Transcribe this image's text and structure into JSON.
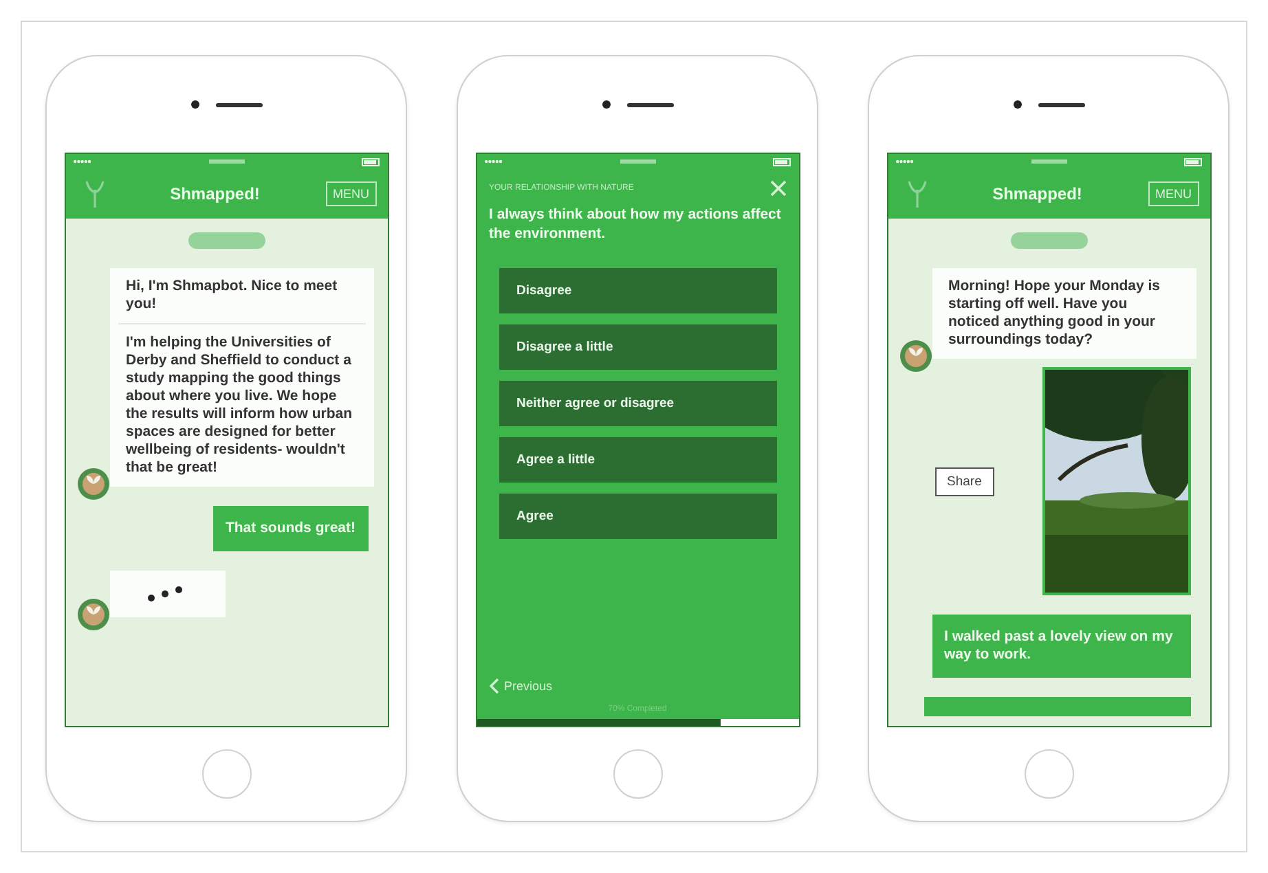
{
  "phones": [
    {
      "kind": "chat",
      "header": {
        "title": "Shmapped!",
        "menu": "MENU"
      },
      "messages": [
        {
          "kind": "bot",
          "paragraphs": [
            "Hi, I'm Shmapbot. Nice to meet you!",
            "I'm helping the Universities of Derby and Sheffield to conduct a study mapping the good things about where you live. We hope the results will inform how urban spaces are designed for better wellbeing of residents- wouldn't that be great!"
          ]
        },
        {
          "kind": "user",
          "text": "That sounds great!"
        },
        {
          "kind": "typing"
        }
      ]
    },
    {
      "kind": "survey",
      "section": "YOUR RELATIONSHIP WITH NATURE",
      "question": "I always think about how my actions affect the environment.",
      "options": [
        "Disagree",
        "Disagree a little",
        "Neither agree or disagree",
        "Agree a little",
        "Agree"
      ],
      "previous": "Previous",
      "progress_text": "70% Completed",
      "level": 0.76
    },
    {
      "kind": "chat",
      "header": {
        "title": "Shmapped!",
        "menu": "MENU"
      },
      "messages": [
        {
          "kind": "bot",
          "paragraphs": [
            "Morning! Hope your Monday is starting off well. Have you noticed anything good in your surroundings today?"
          ]
        },
        {
          "share": "Share"
        },
        {
          "kind": "user",
          "text": "I walked past a lovely view on my way to work."
        },
        {
          "kind": "partial"
        }
      ]
    }
  ]
}
